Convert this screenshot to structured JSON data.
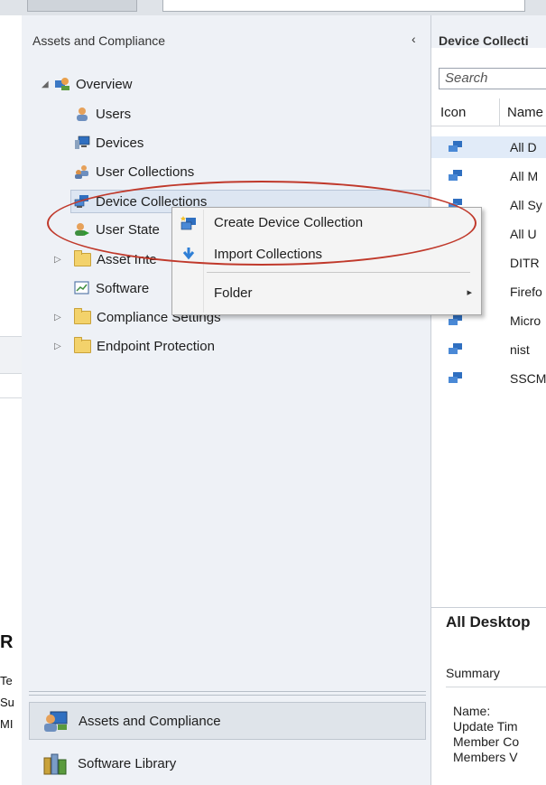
{
  "background_left": {
    "heading_letter": "R",
    "lines": [
      "Te",
      "Su",
      "MI"
    ]
  },
  "nav": {
    "header": "Assets and Compliance",
    "collapse_glyph": "‹",
    "tree": [
      {
        "label": "Overview"
      },
      {
        "label": "Users"
      },
      {
        "label": "Devices"
      },
      {
        "label": "User Collections"
      },
      {
        "label": "Device Collections"
      },
      {
        "label": "User State"
      },
      {
        "label": "Asset Inte"
      },
      {
        "label": "Software"
      },
      {
        "label": "Compliance Settings"
      },
      {
        "label": "Endpoint Protection"
      }
    ],
    "workspaces": [
      {
        "label": "Assets and Compliance"
      },
      {
        "label": "Software Library"
      }
    ]
  },
  "context_menu": {
    "items": [
      {
        "label": "Create Device Collection"
      },
      {
        "label": "Import Collections"
      },
      {
        "label": "Folder",
        "submenu_glyph": "▸"
      }
    ]
  },
  "right_pane": {
    "header": "Device Collecti",
    "search_placeholder": "Search",
    "columns": [
      "Icon",
      "Name"
    ],
    "rows": [
      "All D",
      "All M",
      "All Sy",
      "All U",
      "DITR",
      "Firefo",
      "Micro",
      "nist",
      "SSCM"
    ],
    "details": {
      "title": "All Desktop",
      "section": "Summary",
      "props": [
        "Name:",
        "Update Tim",
        "Member Co",
        "Members V"
      ]
    }
  },
  "colors": {
    "nav_bg": "#eef1f6",
    "selection": "#dde6f2",
    "annotation": "#c0392b"
  }
}
